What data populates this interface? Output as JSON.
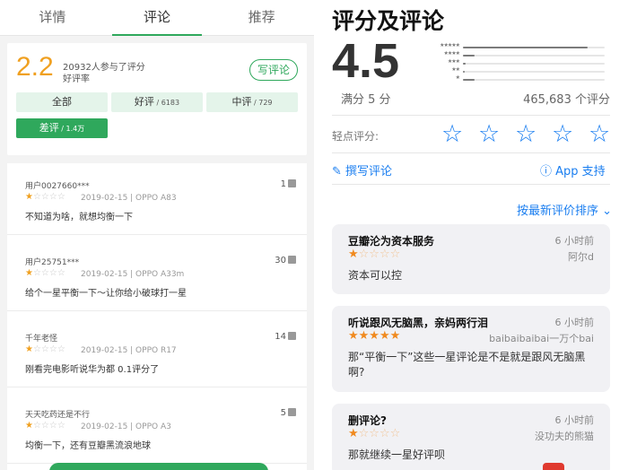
{
  "left": {
    "tabs": [
      "详情",
      "评论",
      "推荐"
    ],
    "summary": {
      "score": "2.2",
      "count_text": "20932人参与了评分",
      "rating_word": "好评率",
      "write_label": "写评论"
    },
    "filters": [
      {
        "label": "全部",
        "sub": ""
      },
      {
        "label": "好评",
        "sub": " / 6183"
      },
      {
        "label": "中评",
        "sub": " / 729"
      },
      {
        "label": "差评",
        "sub": " / 1.4万"
      }
    ],
    "reviews": [
      {
        "user": "用户0027660***",
        "stars": 1,
        "meta": "2019-02-15 | OPPO A83",
        "text": "不知道为啥，就想均衡一下",
        "likes": "1"
      },
      {
        "user": "用户25751***",
        "stars": 1,
        "meta": "2019-02-15 | OPPO A33m",
        "text": "给个一星平衡一下～让你给小破球打一星",
        "likes": "30"
      },
      {
        "user": "千年老怪",
        "stars": 1,
        "meta": "2019-02-15 | OPPO R17",
        "text": "刚看完电影听说华为都 0.1评分了",
        "likes": "14"
      },
      {
        "user": "天天吃药还是不行",
        "stars": 1,
        "meta": "2019-02-15 | OPPO A3",
        "text": "均衡一下，还有豆瓣黑流浪地球",
        "likes": "5"
      }
    ]
  },
  "right": {
    "title": "评分及评论",
    "score": "4.5",
    "out_of": "满分 5 分",
    "total": "465,683 个评分",
    "distribution": [
      0.88,
      0.08,
      0.02,
      0.01,
      0.08
    ],
    "tap_label": "轻点评分:",
    "write_label": "撰写评论",
    "support_label": "App 支持",
    "sort_label": "按最新评价排序 ⌄",
    "reviews": [
      {
        "title": "豆瓣沦为资本服务",
        "time": "6 小时前",
        "stars": 1,
        "author": "阿尔d",
        "body": "资本可以控"
      },
      {
        "title": "听说跟风无脑黑，亲妈两行泪",
        "time": "6 小时前",
        "stars": 5,
        "author": "baibaibaibai一万个bai",
        "body": "那“平衡一下”这些一星评论是不是就是跟风无脑黑啊?"
      },
      {
        "title": "删评论?",
        "time": "6 小时前",
        "stars": 1,
        "author": "没功夫的熊猫",
        "body": "那就继续一星好评呗"
      }
    ]
  },
  "colors": {
    "green": "#2fa85c",
    "orange": "#f0a020",
    "blue": "#1a7ef0",
    "star_orange": "#f08a1f"
  }
}
